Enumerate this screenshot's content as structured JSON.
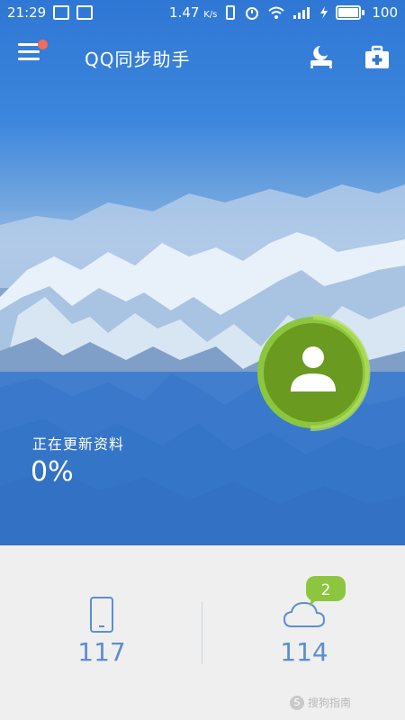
{
  "status_bar": {
    "time": "21:29",
    "speed": "1.47",
    "speed_unit": "K/s",
    "battery": "100"
  },
  "app_bar": {
    "title": "QQ同步助手",
    "icons": [
      "menu-icon",
      "moon-bed-icon",
      "toolbox-icon"
    ]
  },
  "sync": {
    "status_text": "正在更新资料",
    "progress_text": "0%"
  },
  "stats": {
    "local_count": "117",
    "cloud_count": "114",
    "cloud_badge": "2"
  },
  "watermark": {
    "text": "搜狗指南",
    "logo_letter": "S"
  },
  "colors": {
    "accent_blue": "#2f74d0",
    "avatar_green": "#6a9a1f",
    "badge_green": "#8cc63f",
    "notification_dot": "#f26b5b",
    "stat_text": "#5b8ed2"
  }
}
